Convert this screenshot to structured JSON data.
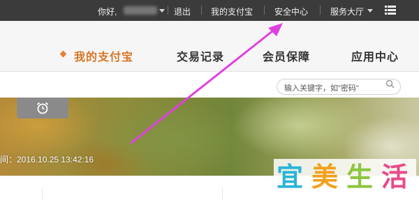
{
  "topbar": {
    "greeting": "你好,",
    "logout": "退出",
    "my_alipay": "我的支付宝",
    "security_center": "安全中心",
    "service_hall": "服务大厅"
  },
  "nav": {
    "items": [
      {
        "label": "我的支付宝"
      },
      {
        "label": "交易记录"
      },
      {
        "label": "会员保障"
      },
      {
        "label": "应用中心"
      }
    ]
  },
  "search": {
    "placeholder": "输入关键字，如\"密码\""
  },
  "banner": {
    "login_time": "间：2016.10.25 13:42:16"
  },
  "watermark": {
    "chars": [
      "宜",
      "美",
      "生",
      "活"
    ]
  },
  "colors": {
    "topbar_bg": "#3b3b3b",
    "nav_active": "#d87523",
    "arrow": "#e040e0"
  }
}
